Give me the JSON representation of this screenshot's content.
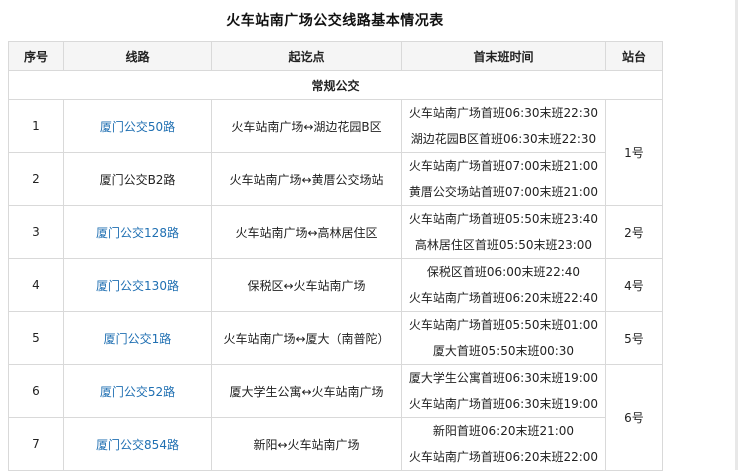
{
  "title": "火车站南广场公交线路基本情况表",
  "headers": {
    "no": "序号",
    "route": "线路",
    "endpoints": "起讫点",
    "times": "首末班时间",
    "stop": "站台"
  },
  "section": "常规公交",
  "rows": [
    {
      "no": "1",
      "route": "厦门公交50路",
      "route_link": true,
      "endpoints": "火车站南广场↔湖边花园B区",
      "times": [
        "火车站南广场首班06:30末班22:30",
        "湖边花园B区首班06:30末班22:30"
      ]
    },
    {
      "no": "2",
      "route": "厦门公交B2路",
      "route_link": false,
      "endpoints": "火车站南广场↔黄厝公交场站",
      "times": [
        "火车站南广场首班07:00末班21:00",
        "黄厝公交场站首班07:00末班21:00"
      ]
    },
    {
      "no": "3",
      "route": "厦门公交128路",
      "route_link": true,
      "endpoints": "火车站南广场↔高林居住区",
      "times": [
        "火车站南广场首班05:50末班23:40",
        "高林居住区首班05:50末班23:00"
      ]
    },
    {
      "no": "4",
      "route": "厦门公交130路",
      "route_link": true,
      "endpoints": "保税区↔火车站南广场",
      "times": [
        "保税区首班06:00末班22:40",
        "火车站南广场首班06:20末班22:40"
      ]
    },
    {
      "no": "5",
      "route": "厦门公交1路",
      "route_link": true,
      "endpoints": "火车站南广场↔厦大（南普陀）",
      "times": [
        "火车站南广场首班05:50末班01:00",
        "厦大首班05:50末班00:30"
      ]
    },
    {
      "no": "6",
      "route": "厦门公交52路",
      "route_link": true,
      "endpoints": "厦大学生公寓↔火车站南广场",
      "times": [
        "厦大学生公寓首班06:30末班19:00",
        "火车站南广场首班06:30末班19:00"
      ]
    },
    {
      "no": "7",
      "route": "厦门公交854路",
      "route_link": true,
      "endpoints": "新阳↔火车站南广场",
      "times": [
        "新阳首班06:20末班21:00",
        "火车站南广场首班06:20末班22:00"
      ]
    }
  ],
  "stops": [
    "1号",
    "2号",
    "4号",
    "5号",
    "6号"
  ],
  "colors": {
    "link": "#1f6fb2",
    "border": "#d9d9d9",
    "header_bg": "#f5f5f5"
  }
}
